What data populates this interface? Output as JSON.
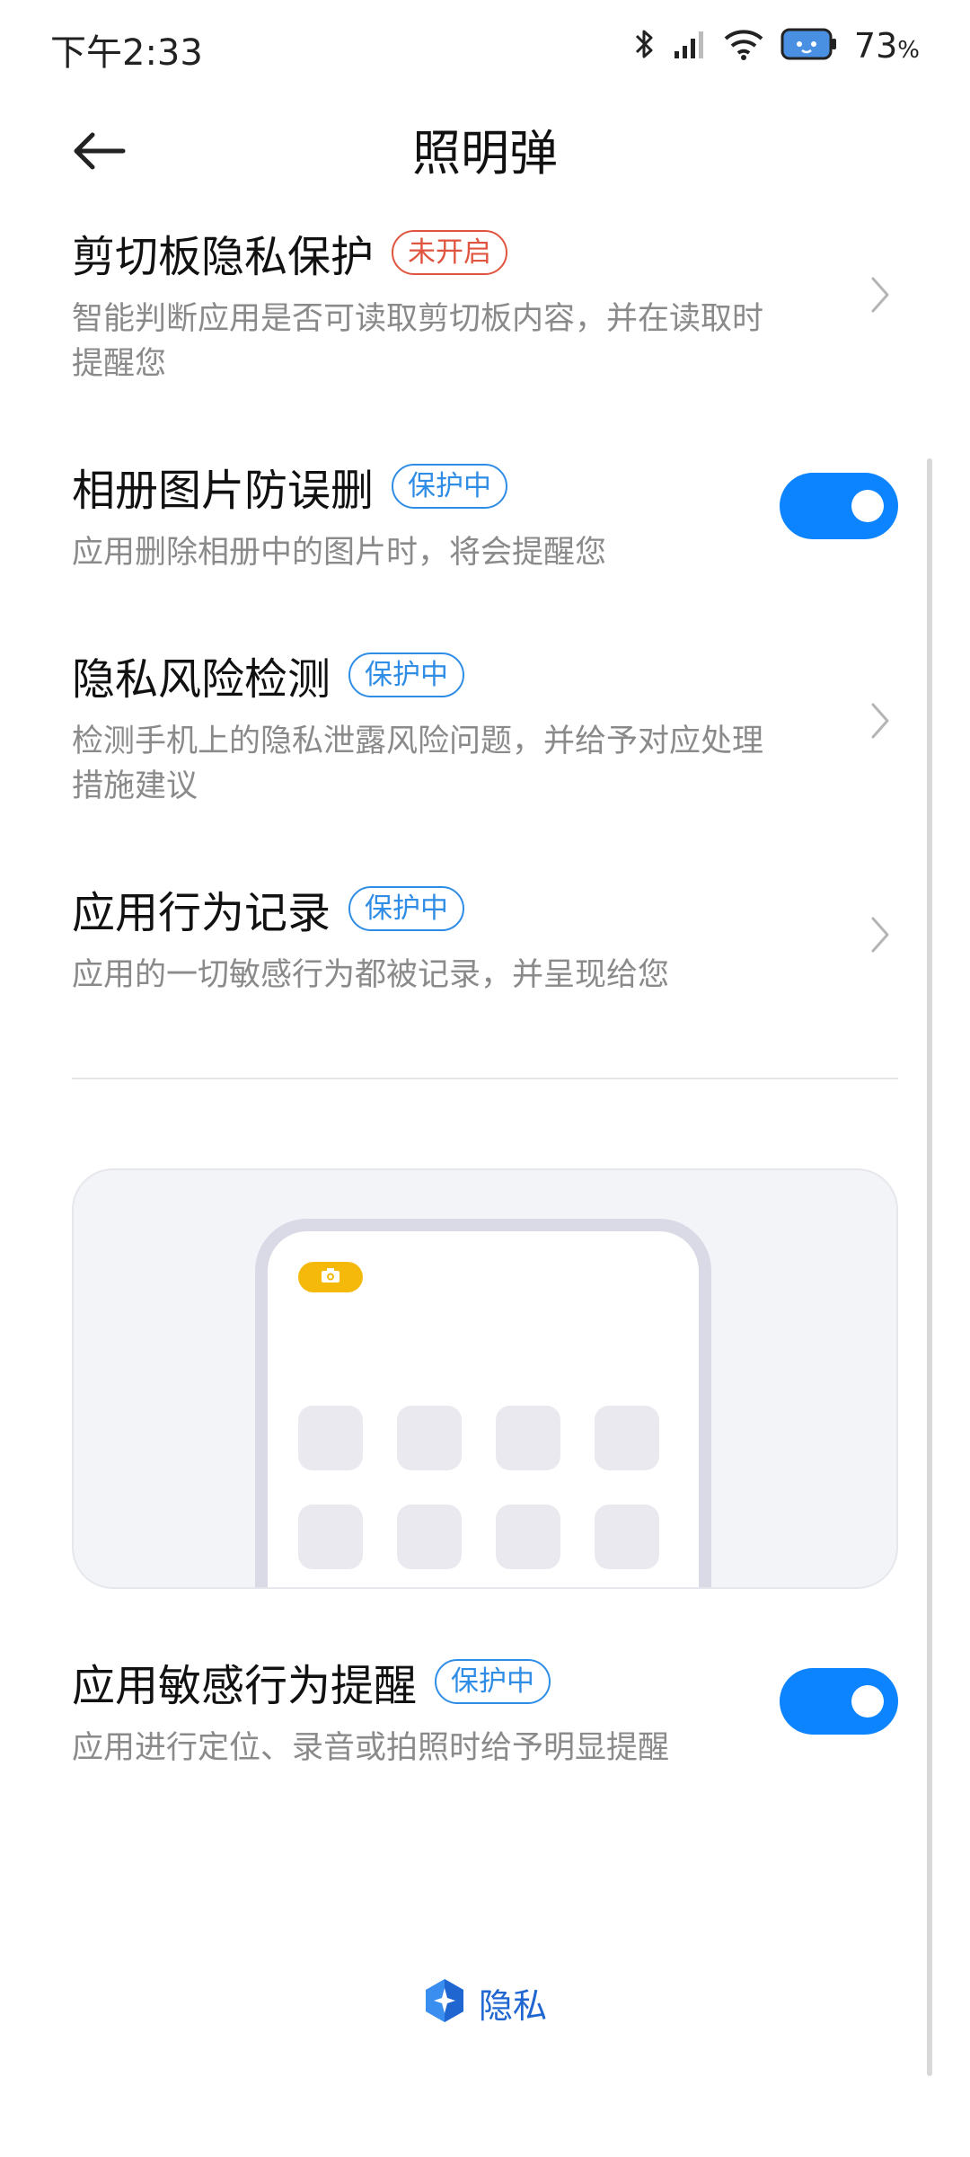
{
  "status_bar": {
    "time": "下午2:33",
    "battery_percent": "73",
    "battery_symbol": "%",
    "icons": [
      "bluetooth-icon",
      "signal-icon",
      "wifi-icon",
      "battery-icon"
    ]
  },
  "header": {
    "back_icon": "arrow-left-icon",
    "title": "照明弹"
  },
  "settings": {
    "clipboard": {
      "title": "剪切板隐私保护",
      "badge": "未开启",
      "desc": "智能判断应用是否可读取剪切板内容，并在读取时提醒您",
      "control": "chevron"
    },
    "album": {
      "title": "相册图片防误删",
      "badge": "保护中",
      "desc": "应用删除相册中的图片时，将会提醒您",
      "control": "toggle",
      "enabled": true
    },
    "risk": {
      "title": "隐私风险检测",
      "badge": "保护中",
      "desc": "检测手机上的隐私泄露风险问题，并给予对应处理措施建议",
      "control": "chevron"
    },
    "behavior": {
      "title": "应用行为记录",
      "badge": "保护中",
      "desc": "应用的一切敏感行为都被记录，并呈现给您",
      "control": "chevron"
    },
    "sensitive": {
      "title": "应用敏感行为提醒",
      "badge": "保护中",
      "desc": "应用进行定位、录音或拍照时给予明显提醒",
      "control": "toggle",
      "enabled": true
    }
  },
  "illustration": {
    "icon": "camera-icon"
  },
  "footer": {
    "brand_icon": "privacy-shield-icon",
    "brand_text": "隐私"
  },
  "colors": {
    "accent": "#0d84ff",
    "badge_on": "#2f8de6",
    "badge_off": "#e0553f",
    "camera_pill": "#f5b90b",
    "brand": "#1f66d1"
  }
}
